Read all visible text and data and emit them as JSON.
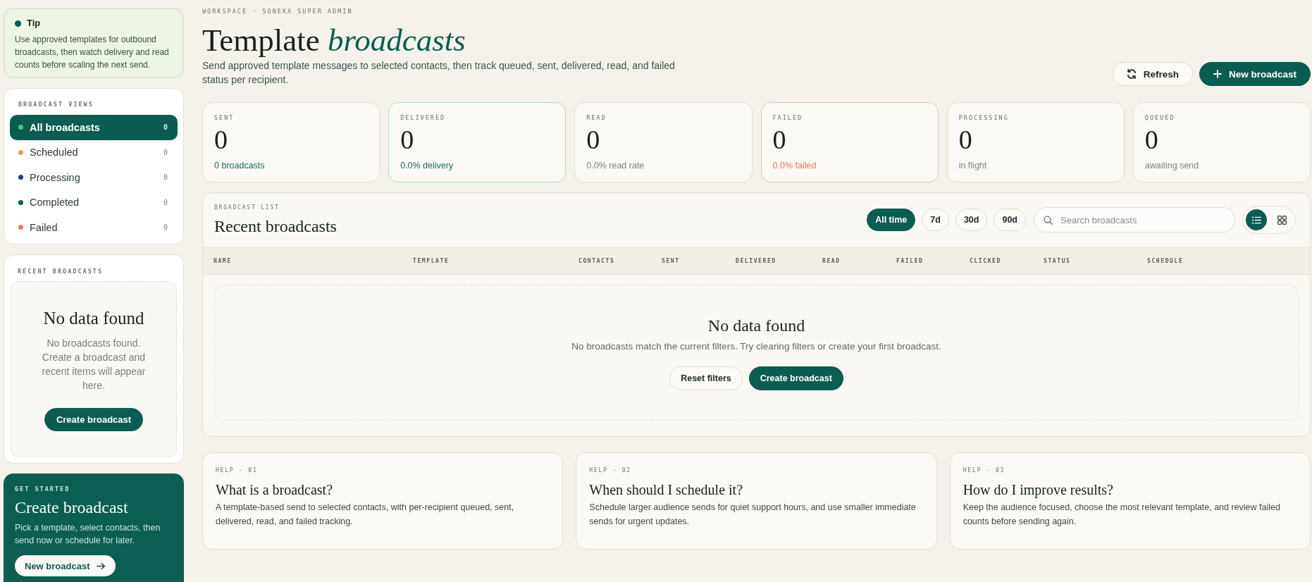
{
  "tip": {
    "title": "Tip",
    "text": "Use approved templates for outbound broadcasts, then watch delivery and read counts before scaling the next send."
  },
  "views": {
    "heading": "BROADCAST VIEWS",
    "items": [
      {
        "label": "All broadcasts",
        "count": "0",
        "color": "#3ecf6a",
        "selected": true
      },
      {
        "label": "Scheduled",
        "count": "0",
        "color": "#e3a050",
        "selected": false
      },
      {
        "label": "Processing",
        "count": "0",
        "color": "#1d3f8c",
        "selected": false
      },
      {
        "label": "Completed",
        "count": "0",
        "color": "#0b5d51",
        "selected": false
      },
      {
        "label": "Failed",
        "count": "0",
        "color": "#ea7c60",
        "selected": false
      }
    ]
  },
  "recent": {
    "heading": "RECENT BROADCASTS",
    "empty_title": "No data found",
    "empty_text": "No broadcasts found. Create a broadcast and recent items will appear here.",
    "button": "Create broadcast"
  },
  "get_started": {
    "eyebrow": "GET STARTED",
    "title": "Create broadcast",
    "text": "Pick a template, select contacts, then send now or schedule for later.",
    "button": "New broadcast"
  },
  "header": {
    "breadcrumb": "WORKSPACE · SONEKA SUPER ADMIN",
    "title": "Template *broadcasts*",
    "subtitle": "Send approved template messages to selected contacts, then track queued, sent, delivered, read, and failed status per recipient.",
    "actions": [
      {
        "label": "Refresh",
        "kind": "refresh"
      },
      {
        "label": "New broadcast",
        "kind": "create"
      }
    ]
  },
  "stats": [
    {
      "label": "SENT",
      "value": "0",
      "note": "0 broadcasts",
      "kind": "accent"
    },
    {
      "label": "DELIVERED",
      "value": "0",
      "note": "0.0% delivery",
      "kind": "success"
    },
    {
      "label": "READ",
      "value": "0",
      "note": "0.0% read rate",
      "kind": "muted"
    },
    {
      "label": "FAILED",
      "value": "0",
      "note": "0.0% failed",
      "kind": "danger"
    },
    {
      "label": "PROCESSING",
      "value": "0",
      "note": "in flight",
      "kind": "warning"
    },
    {
      "label": "QUEUED",
      "value": "0",
      "note": "awaiting send",
      "kind": "muted"
    }
  ],
  "list": {
    "eyebrow": "BROADCAST LIST",
    "title": "Recent broadcasts",
    "periods": [
      {
        "label": "All time",
        "selected": true
      },
      {
        "label": "7d",
        "selected": false
      },
      {
        "label": "30d",
        "selected": false
      },
      {
        "label": "90d",
        "selected": false
      }
    ],
    "search": {
      "placeholder": "Search broadcasts"
    },
    "view_modes": [
      {
        "kind": "list",
        "selected": true
      },
      {
        "kind": "grid",
        "selected": false
      }
    ],
    "columns": [
      "NAME",
      "TEMPLATE",
      "CONTACTS",
      "SENT",
      "DELIVERED",
      "READ",
      "FAILED",
      "CLICKED",
      "STATUS",
      "SCHEDULE"
    ],
    "empty": {
      "title": "No data found",
      "text": "No broadcasts match the current filters. Try clearing filters or create your first broadcast.",
      "buttons": [
        {
          "label": "Reset filters",
          "kind": "secondary"
        },
        {
          "label": "Create broadcast",
          "kind": "primary"
        }
      ]
    }
  },
  "help": [
    {
      "eyebrow": "HELP - 01",
      "title": "What is a broadcast?",
      "text": "A template-based send to selected contacts, with per-recipient queued, sent, delivered, read, and failed tracking."
    },
    {
      "eyebrow": "HELP - 02",
      "title": "When should I schedule it?",
      "text": "Schedule larger audience sends for quiet support hours, and use smaller immediate sends for urgent updates."
    },
    {
      "eyebrow": "HELP - 03",
      "title": "How do I improve results?",
      "text": "Keep the audience focused, choose the most relevant template, and review failed counts before sending again."
    }
  ]
}
